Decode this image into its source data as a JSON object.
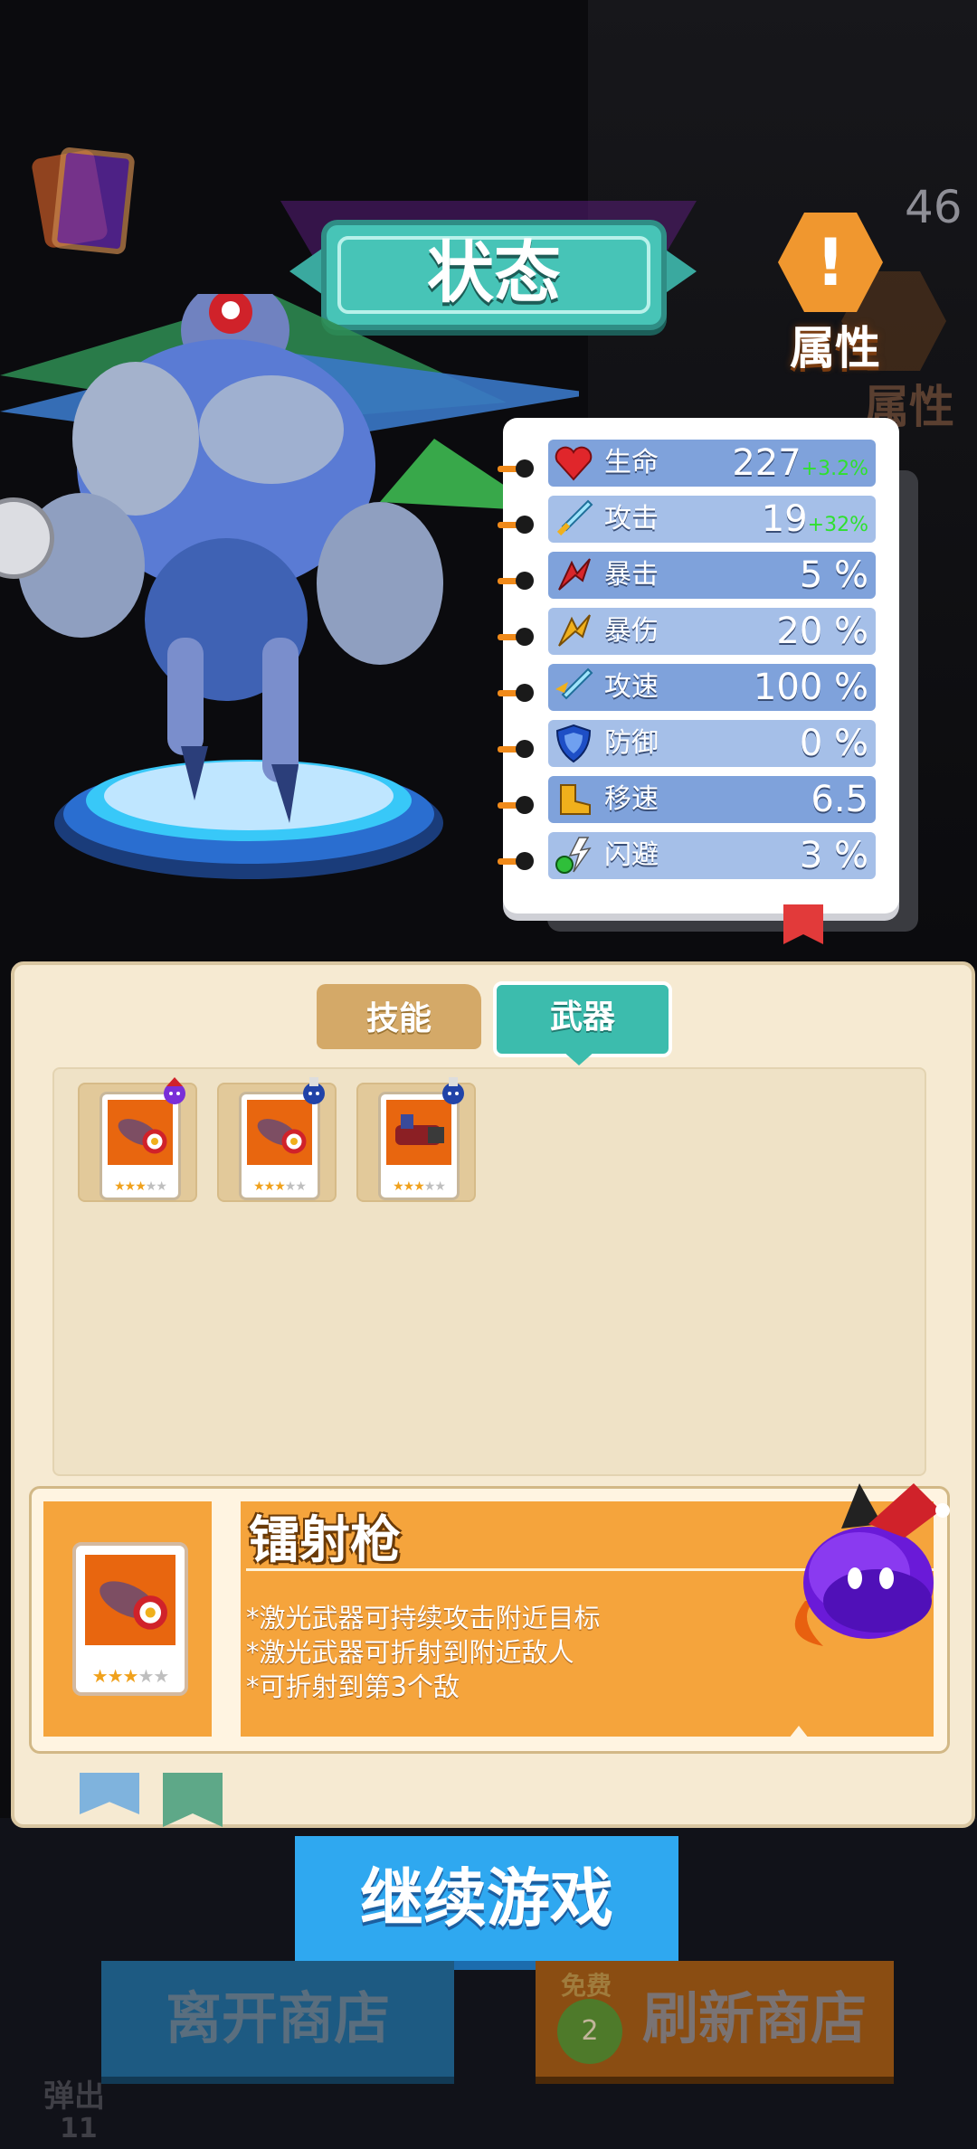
{
  "score": "46",
  "title": "状态",
  "attribute_badge": {
    "label": "属性",
    "ghost_label": "属性"
  },
  "stats": [
    {
      "label": "生命",
      "value": "227",
      "bonus": "+3.2%",
      "icon": "heart-icon",
      "color": "#e0262b"
    },
    {
      "label": "攻击",
      "value": "19",
      "bonus": "+32%",
      "icon": "sword-icon",
      "color": "#5ac8f0"
    },
    {
      "label": "暴击",
      "value": "5 %",
      "bonus": "",
      "icon": "crit-arrow-icon",
      "color": "#d8262b"
    },
    {
      "label": "暴伤",
      "value": "20 %",
      "bonus": "",
      "icon": "crit-damage-icon",
      "color": "#f0b01c"
    },
    {
      "label": "攻速",
      "value": "100 %",
      "bonus": "",
      "icon": "attack-speed-icon",
      "color": "#5ac8f0"
    },
    {
      "label": "防御",
      "value": "0 %",
      "bonus": "",
      "icon": "shield-icon",
      "color": "#1e4fc6"
    },
    {
      "label": "移速",
      "value": "6.5",
      "bonus": "",
      "icon": "boot-icon",
      "color": "#f0b01c"
    },
    {
      "label": "闪避",
      "value": "3 %",
      "bonus": "",
      "icon": "dodge-icon",
      "color": "#2fbf3a"
    }
  ],
  "tabs": {
    "skill": "技能",
    "weapon": "武器"
  },
  "weapons": [
    {
      "name": "laser-gun",
      "stars": 3,
      "badge_color": "#7a2fd8"
    },
    {
      "name": "laser-gun",
      "stars": 3,
      "badge_color": "#2143a8"
    },
    {
      "name": "cannon",
      "stars": 3,
      "badge_color": "#2143a8"
    }
  ],
  "detail": {
    "name": "镭射枪",
    "description": [
      "*激光武器可持续攻击附近目标",
      "*激光武器可折射到附近敌人",
      "*可折射到第3个敌"
    ],
    "stars": 3
  },
  "buttons": {
    "continue": "继续游戏",
    "leave_shop": "离开商店",
    "refresh_shop": "刷新商店",
    "refresh_free": "免费",
    "refresh_count": "2"
  },
  "eject": {
    "label": "弹出",
    "count": "11"
  }
}
